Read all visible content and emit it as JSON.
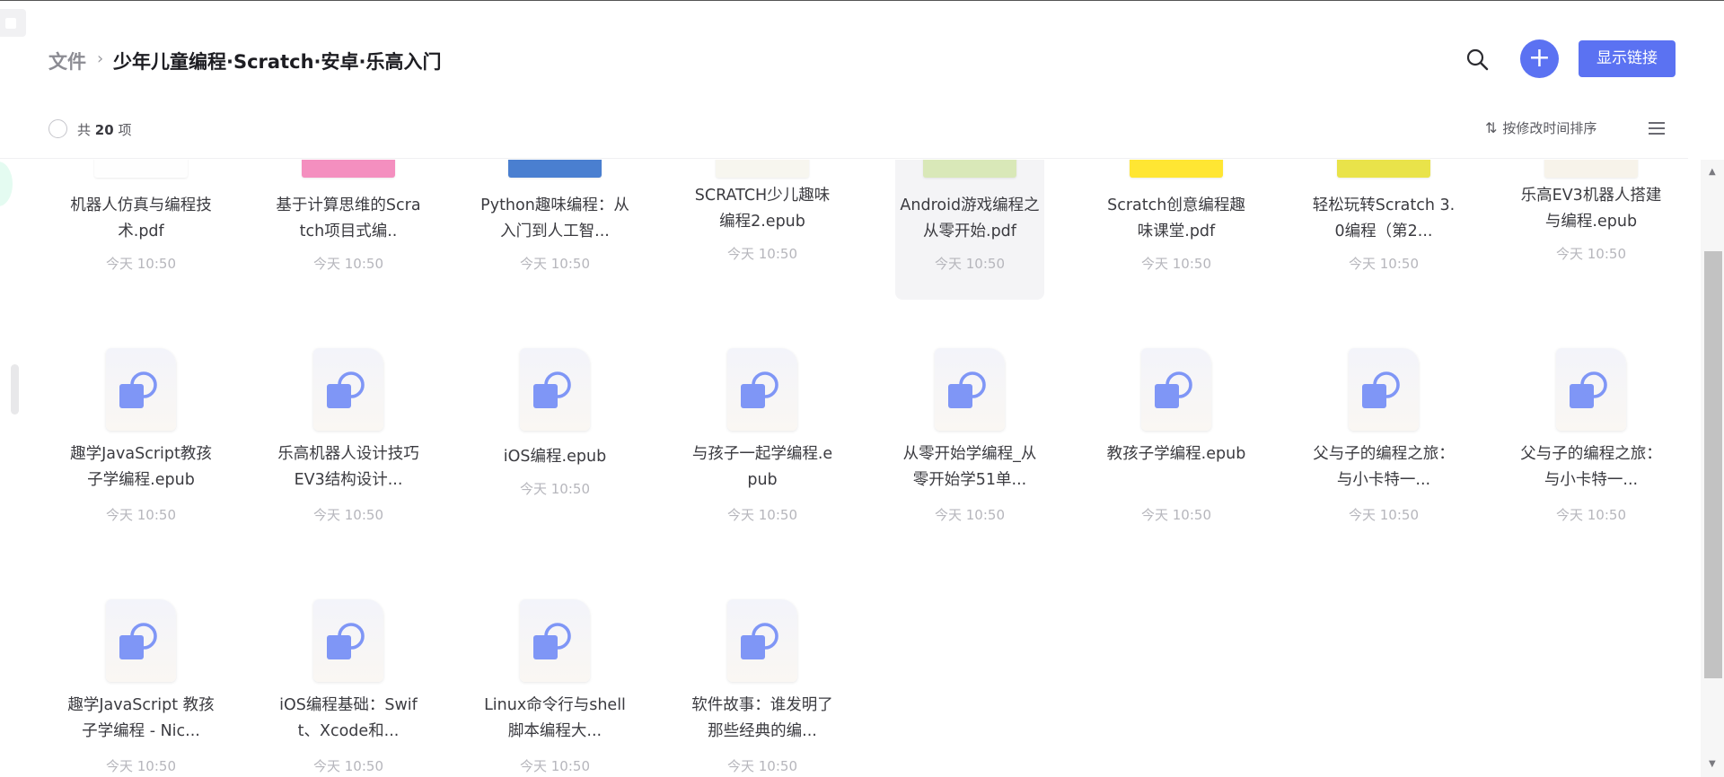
{
  "breadcrumb": {
    "root": "文件",
    "separator": "›",
    "current": "少年儿童编程·Scratch·安卓·乐高入门"
  },
  "actions": {
    "add_label": "+",
    "show_link_label": "显示链接"
  },
  "toolbar": {
    "count_prefix": "共",
    "count_value": "20",
    "count_suffix": "项",
    "sort_label": "按修改时间排序",
    "sort_icon": "⇅"
  },
  "colors": {
    "accent": "#5b72f2",
    "file_icon": "#7f96f6"
  },
  "files": [
    {
      "name": "机器人仿真与编程技术.pdf",
      "time": "今天 10:50",
      "thumb": "cover",
      "cover_color": "#fefefe"
    },
    {
      "name": "基于计算思维的Scratch项目式编..",
      "time": "今天 10:50",
      "thumb": "cover",
      "cover_color": "#f48fbf"
    },
    {
      "name": "Python趣味编程：从入门到人工智...",
      "time": "今天 10:50",
      "thumb": "cover",
      "cover_color": "#4a7fd0"
    },
    {
      "name": "SCRATCH少儿趣味编程2.epub",
      "time": "今天 10:50",
      "thumb": "cover",
      "cover_color": "#f7f6ef"
    },
    {
      "name": "Android游戏编程之从零开始.pdf",
      "time": "今天 10:50",
      "thumb": "cover",
      "cover_color": "#d9e8b8"
    },
    {
      "name": "Scratch创意编程趣味课堂.pdf",
      "time": "今天 10:50",
      "thumb": "cover",
      "cover_color": "#ffe633"
    },
    {
      "name": "轻松玩转Scratch 3.0编程（第2...",
      "time": "今天 10:50",
      "thumb": "cover",
      "cover_color": "#e9e34a"
    },
    {
      "name": "乐高EV3机器人搭建与编程.epub",
      "time": "今天 10:50",
      "thumb": "cover",
      "cover_color": "#f7f3ea"
    },
    {
      "name": "趣学JavaScript教孩子学编程.epub",
      "time": "今天 10:50",
      "thumb": "doc"
    },
    {
      "name": "乐高机器人设计技巧EV3结构设计...",
      "time": "今天 10:50",
      "thumb": "doc"
    },
    {
      "name": "iOS编程.epub",
      "time": "今天 10:50",
      "thumb": "doc"
    },
    {
      "name": "与孩子一起学编程.epub",
      "time": "今天 10:50",
      "thumb": "doc"
    },
    {
      "name": "从零开始学编程_从零开始学51单...",
      "time": "今天 10:50",
      "thumb": "doc"
    },
    {
      "name": "教孩子学编程.epub",
      "time": "今天 10:50",
      "thumb": "doc"
    },
    {
      "name": "父与子的编程之旅：与小卡特一...",
      "time": "今天 10:50",
      "thumb": "doc"
    },
    {
      "name": "父与子的编程之旅：与小卡特一...",
      "time": "今天 10:50",
      "thumb": "doc"
    },
    {
      "name": "趣学JavaScript 教孩子学编程 - Nic...",
      "time": "今天 10:50",
      "thumb": "doc"
    },
    {
      "name": "iOS编程基础：Swift、Xcode和...",
      "time": "今天 10:50",
      "thumb": "doc"
    },
    {
      "name": "Linux命令行与shell脚本编程大...",
      "time": "今天 10:50",
      "thumb": "doc"
    },
    {
      "name": "软件故事：谁发明了那些经典的编...",
      "time": "今天 10:50",
      "thumb": "doc"
    }
  ],
  "scrollbar": {
    "up": "▲",
    "down": "▼"
  }
}
